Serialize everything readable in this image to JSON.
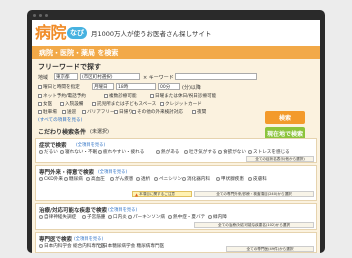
{
  "header": {
    "logo_main": "病院",
    "logo_sub": "なび",
    "tagline": "月1000万人が使うお医者さん探しサイト"
  },
  "band": {
    "title": "病院・医院・薬局 を検索"
  },
  "freeword": {
    "title": "フリーワードで探す",
    "area_label": "地域",
    "pref_value": "東京都",
    "city_value": "(市区町村選択)",
    "keyword_sep": "× キーワード",
    "keyword_placeholder": "(診療科,病名など)",
    "time_check": "曜日と時間を指定",
    "day_value": "月曜日",
    "hour_value": "18時",
    "until_value": "(分)以降",
    "min_value": "00分",
    "opt1": "ネット予約/電話予約",
    "opt2": "複数診療可能",
    "opt3": "日曜または休日/祝日診療可能",
    "opt4": "女医",
    "opt5": "入院設備",
    "opt6": "託児所または子どもスペース",
    "opt7": "クレジットカード",
    "opt8": "駐車場",
    "opt9": "送迎",
    "opt10": "バリアフリー",
    "opt11": "日帰り",
    "opt12": "その他の外来検討対応",
    "opt13": "夜間",
    "more_link": "(すべての項目を見る)",
    "search_button": "検索",
    "nearby_button": "現在地で検索"
  },
  "conditions": {
    "title": "こだわり検索条件",
    "unselected": "(未選択)"
  },
  "symptom": {
    "title": "症状で検索",
    "req": "(全項目を見る)",
    "items": [
      "だるい",
      "寝れない・不眠",
      "疲れやすい・疲れる",
      "熱がある",
      "吐き気がする",
      "食欲がない",
      "ストレスを感じる"
    ],
    "sub_button": "全ての症状名表示(他から選択)"
  },
  "specialty": {
    "title": "専門外来・得意で検索",
    "req": "(全項目を見る)",
    "items": [
      "CKD外来",
      "糖尿病",
      "高血圧",
      "がん疾患",
      "透析",
      "ペニシリン",
      "消化器内科",
      "甲状腺疾患",
      "産婦人科",
      "内科",
      "皮膚科"
    ],
    "warn": "本項目に関するご注意",
    "sub_button": "全ての専門外来/診療・検査項目(240)から選択"
  },
  "treatment": {
    "title": "治療/対応可能な疾患で検索",
    "req": "(全項目を見る)",
    "items": [
      "自律神経失調症",
      "子宮筋腫",
      "口内炎",
      "パーキンソン病",
      "熱中症・夏バテ",
      "緑内障"
    ],
    "sub_button": "全ての治療/対応可能な疾患名(102)から選択"
  },
  "doctor": {
    "title": "専門医で検索",
    "req": "(全項目を見る)",
    "items": [
      "日本内科学会 総合内科専門医",
      "日本糖尿病学会 糖尿病専門医"
    ],
    "sub_button": "全ての専門医(49件)から選択"
  }
}
